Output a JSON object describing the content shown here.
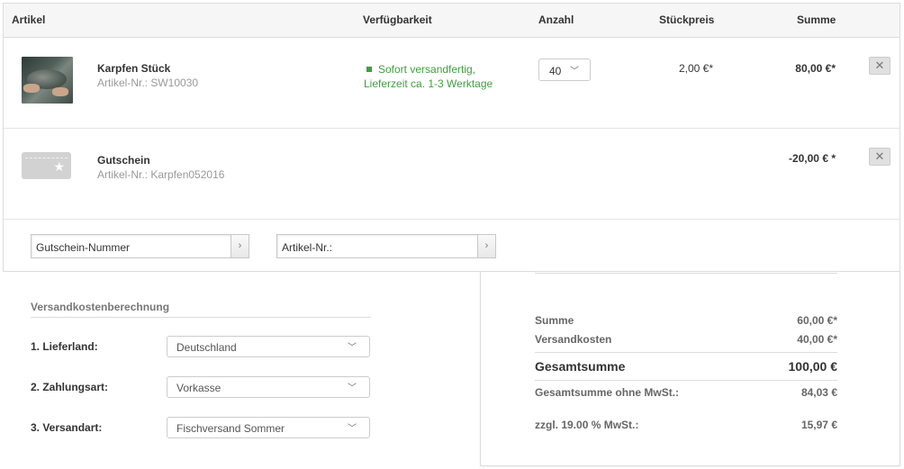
{
  "table": {
    "headers": {
      "article": "Artikel",
      "availability": "Verfügbarkeit",
      "quantity": "Anzahl",
      "unit_price": "Stückpreis",
      "sum": "Summe"
    },
    "items": [
      {
        "name": "Karpfen Stück",
        "article_nr": "Artikel-Nr.: SW10030",
        "availability_line1": "Sofort versandfertig,",
        "availability_line2": "Lieferzeit ca. 1-3 Werktage",
        "quantity": "40",
        "unit_price": "2,00 €*",
        "sum": "80,00 €*",
        "remove": "✕"
      },
      {
        "name": "Gutschein",
        "article_nr": "Artikel-Nr.: Karpfen052016",
        "sum": "-20,00 € *",
        "remove": "✕"
      }
    ]
  },
  "inputs": {
    "voucher_placeholder": "Gutschein-Nummer",
    "article_placeholder": "Artikel-Nr.:",
    "submit_glyph": "›"
  },
  "shipping": {
    "title": "Versandkostenberechnung",
    "country_label": "1. Lieferland:",
    "country_value": "Deutschland",
    "payment_label": "2. Zahlungsart:",
    "payment_value": "Vorkasse",
    "method_label": "3. Versandart:",
    "method_value": "Fischversand Sommer"
  },
  "totals": {
    "sum_label": "Summe",
    "sum_value": "60,00 €*",
    "shipping_label": "Versandkosten",
    "shipping_value": "40,00 €*",
    "total_label": "Gesamtsumme",
    "total_value": "100,00 €",
    "net_label": "Gesamtsumme ohne MwSt.:",
    "net_value": "84,03 €",
    "tax_label": "zzgl. 19.00 % MwSt.:",
    "tax_value": "15,97 €"
  },
  "colors": {
    "availability_green": "#3fa03f",
    "header_bg": "#f6f6f6",
    "border": "#dcdcdc"
  },
  "icons": {
    "chevron": "chevron-down-icon",
    "remove": "close-icon",
    "voucher": "voucher-star-icon",
    "submit": "chevron-right-icon"
  }
}
